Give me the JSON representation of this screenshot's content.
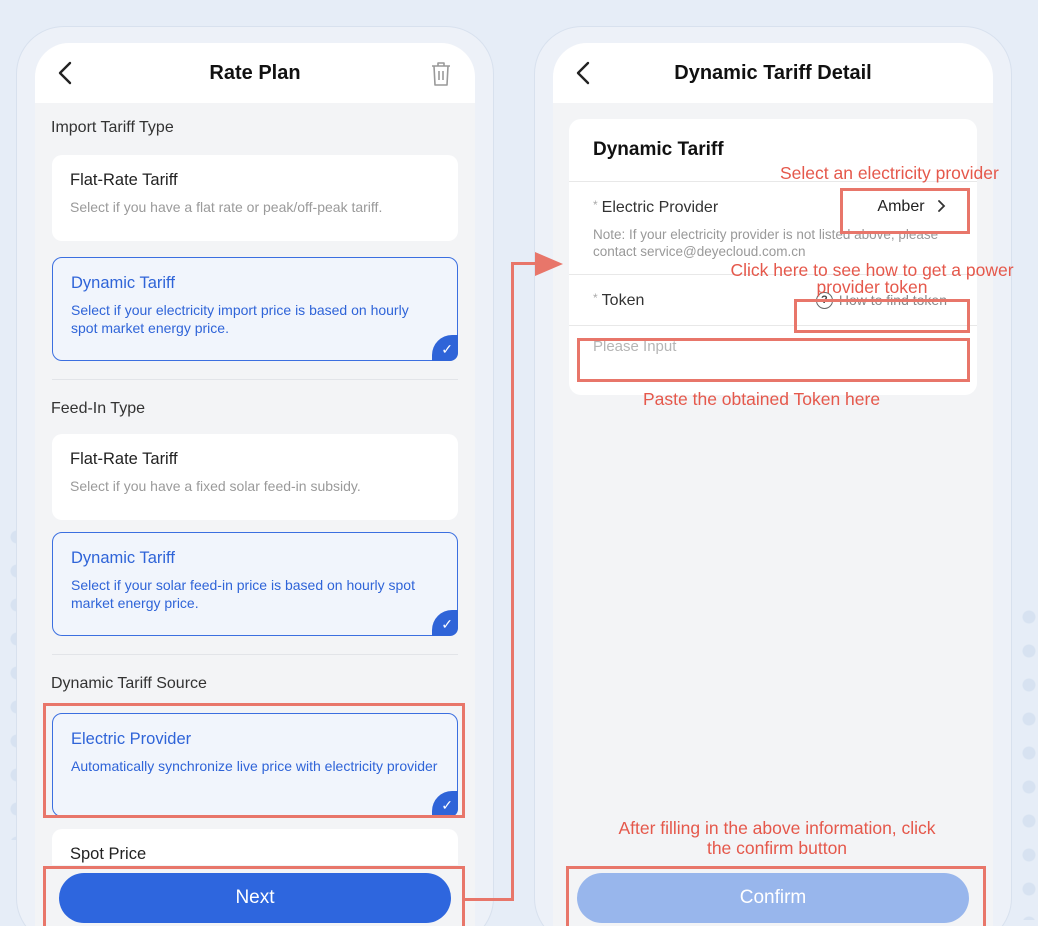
{
  "left": {
    "title": "Rate Plan",
    "import_label": "Import Tariff Type",
    "import_cards": [
      {
        "title": "Flat-Rate Tariff",
        "desc": "Select if you have a flat rate or peak/off-peak tariff."
      },
      {
        "title": "Dynamic Tariff",
        "desc": "Select if your electricity import price is based on hourly spot market energy price."
      }
    ],
    "feedin_label": "Feed-In Type",
    "feedin_cards": [
      {
        "title": "Flat-Rate Tariff",
        "desc": "Select if you have a fixed solar feed-in subsidy."
      },
      {
        "title": "Dynamic Tariff",
        "desc": "Select if your solar feed-in price is based on hourly spot market energy price."
      }
    ],
    "source_label": "Dynamic Tariff Source",
    "source_cards": [
      {
        "title": "Electric Provider",
        "desc": "Automatically synchronize live price with electricity provider"
      },
      {
        "title": "Spot Price",
        "desc": ""
      }
    ],
    "next_label": "Next"
  },
  "right": {
    "title": "Dynamic Tariff Detail",
    "panel_title": "Dynamic Tariff",
    "provider_label": "Electric Provider",
    "provider_value": "Amber",
    "note": "Note: If your electricity provider is not listed above, please contact service@deyecloud.com.cn",
    "token_label": "Token",
    "howto_label": "How to find token",
    "token_placeholder": "Please Input",
    "confirm_label": "Confirm",
    "required_mark": "*"
  },
  "annotations": {
    "select_provider": "Select an electricity provider",
    "click_here": "Click here to see how to get a power provider token",
    "paste_token": "Paste the obtained Token here",
    "after_fill": "After filling in the above information, click the confirm button"
  },
  "icons": {
    "back": "chevron-left-icon",
    "trash": "trash-icon",
    "check": "checkmark-icon",
    "chevron": "chevron-right-icon",
    "question": "question-circle-icon"
  },
  "colors": {
    "accent": "#2e66de",
    "confirm_disabled": "#98b6ec",
    "annotation": "#e5584b"
  }
}
